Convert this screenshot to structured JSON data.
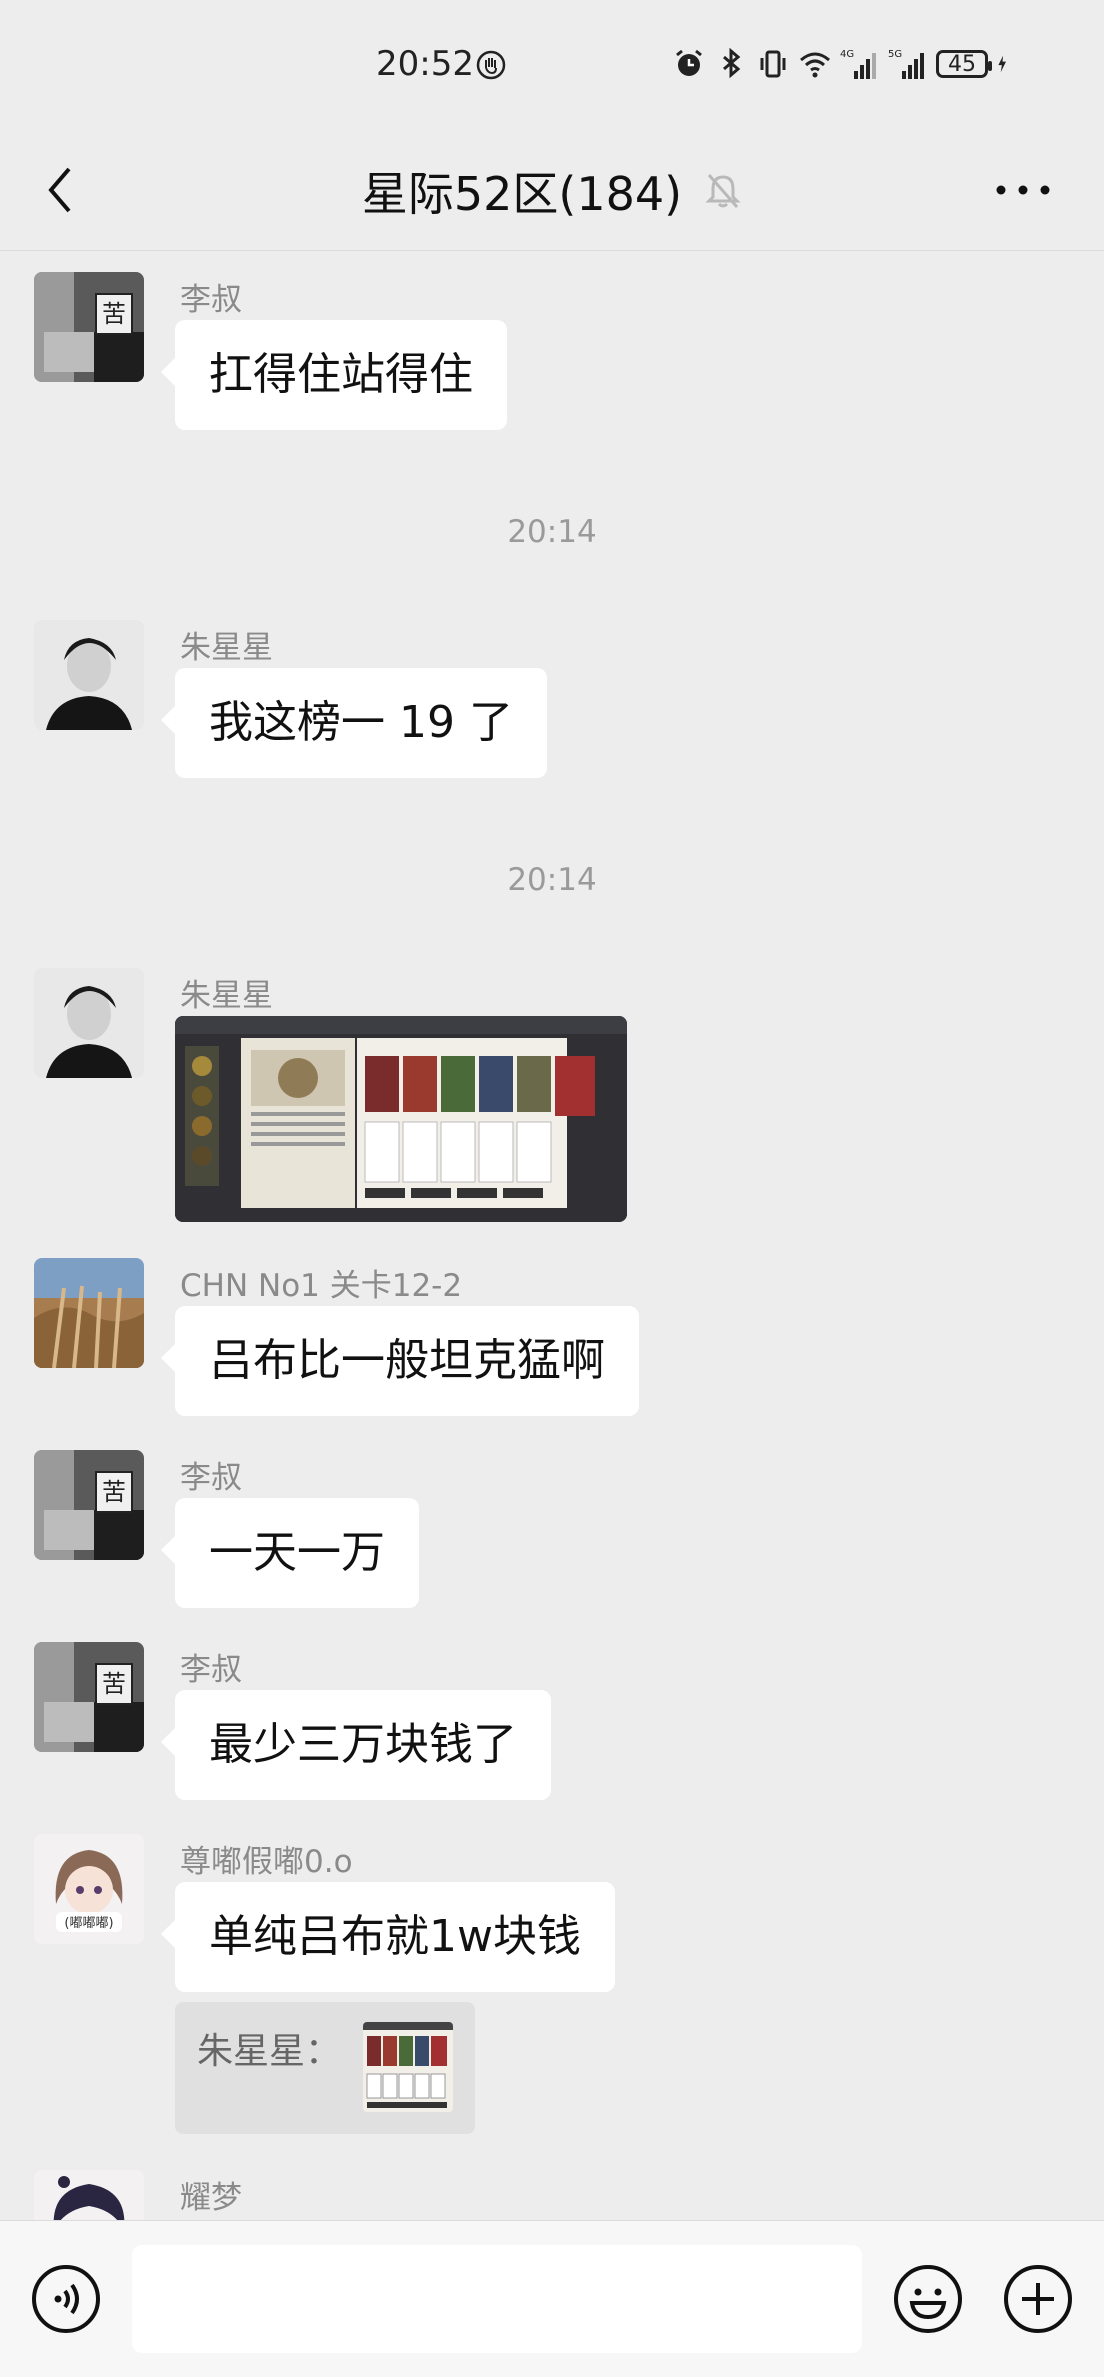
{
  "status_bar": {
    "time": "20:52",
    "battery": "45",
    "net1": "4G",
    "net2": "5G"
  },
  "header": {
    "title": "星际52区(184)"
  },
  "messages": [
    {
      "sender": "李叔",
      "text": "扛得住站得住"
    },
    {
      "timestamp": "20:14"
    },
    {
      "sender": "朱星星",
      "text": "我这榜一 19 了"
    },
    {
      "timestamp": "20:14"
    },
    {
      "sender": "朱星星",
      "type": "image"
    },
    {
      "sender": "CHN No1 关卡12-2",
      "text": "吕布比一般坦克猛啊"
    },
    {
      "sender": "李叔",
      "text": "一天一万"
    },
    {
      "sender": "李叔",
      "text": "最少三万块钱了"
    },
    {
      "sender": "尊嘟假嘟0.o",
      "text": "单纯吕布就1w块钱",
      "avatar_text": "(嘟嘟嘟)",
      "quote": {
        "label": "朱星星："
      }
    },
    {
      "sender": "耀梦"
    }
  ],
  "input": {
    "placeholder": ""
  },
  "colors": {
    "background": "#ededed",
    "bubble": "#ffffff",
    "meta": "#8a8a8a"
  }
}
